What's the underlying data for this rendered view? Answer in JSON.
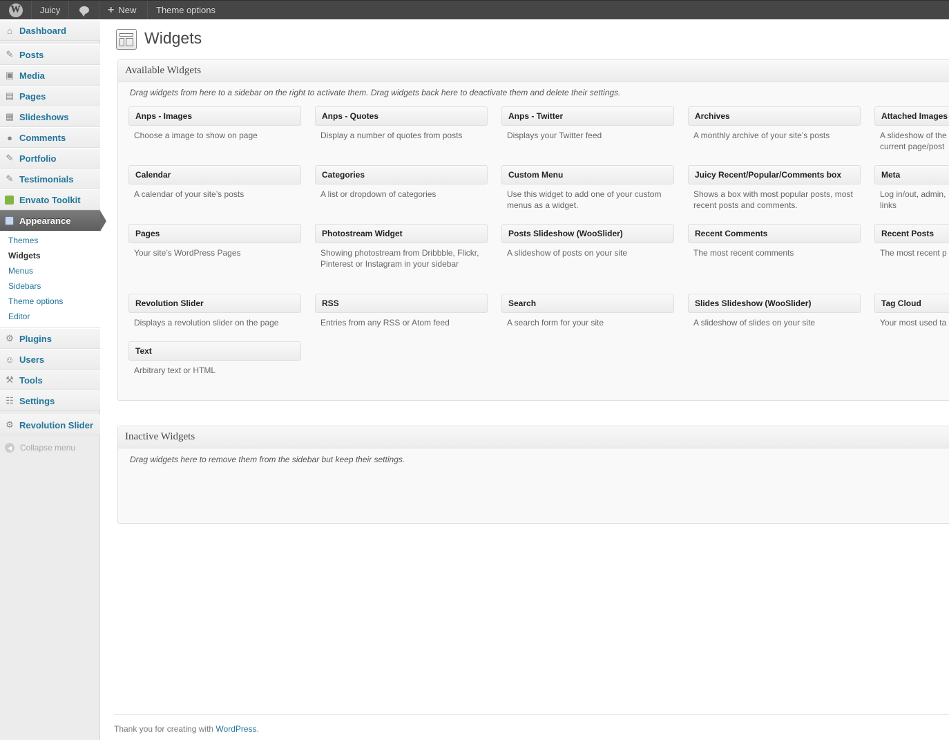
{
  "adminbar": {
    "site_name": "Juicy",
    "new_label": "New",
    "theme_options": "Theme options"
  },
  "sidebar": {
    "items": [
      {
        "label": "Dashboard",
        "icon": "dashboard-icon"
      },
      {
        "label": "Posts",
        "icon": "pin-icon"
      },
      {
        "label": "Media",
        "icon": "media-icon"
      },
      {
        "label": "Pages",
        "icon": "pages-icon"
      },
      {
        "label": "Slideshows",
        "icon": "slideshow-icon"
      },
      {
        "label": "Comments",
        "icon": "comments-icon"
      },
      {
        "label": "Portfolio",
        "icon": "pin-icon"
      },
      {
        "label": "Testimonials",
        "icon": "pin-icon"
      },
      {
        "label": "Envato Toolkit",
        "icon": "envato-icon"
      },
      {
        "label": "Appearance",
        "icon": "appearance-icon"
      },
      {
        "label": "Plugins",
        "icon": "plugins-icon"
      },
      {
        "label": "Users",
        "icon": "users-icon"
      },
      {
        "label": "Tools",
        "icon": "tools-icon"
      },
      {
        "label": "Settings",
        "icon": "settings-icon"
      },
      {
        "label": "Revolution Slider",
        "icon": "gear-icon"
      }
    ],
    "submenu": [
      "Themes",
      "Widgets",
      "Menus",
      "Sidebars",
      "Theme options",
      "Editor"
    ],
    "collapse": "Collapse menu"
  },
  "page": {
    "title": "Widgets"
  },
  "available": {
    "title": "Available Widgets",
    "description": "Drag widgets from here to a sidebar on the right to activate them. Drag widgets back here to deactivate them and delete their settings.",
    "widgets": [
      {
        "title": "Anps - Images",
        "desc": "Choose a image to show on page"
      },
      {
        "title": "Anps - Quotes",
        "desc": "Display a number of quotes from posts"
      },
      {
        "title": "Anps - Twitter",
        "desc": "Displays your Twitter feed"
      },
      {
        "title": "Archives",
        "desc": "A monthly archive of your site’s posts"
      },
      {
        "title": "Attached Images",
        "desc": "A slideshow of the current page/post"
      },
      {
        "title": "Calendar",
        "desc": "A calendar of your site’s posts"
      },
      {
        "title": "Categories",
        "desc": "A list or dropdown of categories"
      },
      {
        "title": "Custom Menu",
        "desc": "Use this widget to add one of your custom menus as a widget."
      },
      {
        "title": "Juicy Recent/Popular/Comments box",
        "desc": "Shows a box with most popular posts, most recent posts and comments."
      },
      {
        "title": "Meta",
        "desc": "Log in/out, admin, links"
      },
      {
        "title": "Pages",
        "desc": "Your site’s WordPress Pages"
      },
      {
        "title": "Photostream Widget",
        "desc": "Showing photostream from Dribbble, Flickr, Pinterest or Instagram in your sidebar"
      },
      {
        "title": "Posts Slideshow (WooSlider)",
        "desc": "A slideshow of posts on your site"
      },
      {
        "title": "Recent Comments",
        "desc": "The most recent comments"
      },
      {
        "title": "Recent Posts",
        "desc": "The most recent p"
      },
      {
        "title": "Revolution Slider",
        "desc": "Displays a revolution slider on the page"
      },
      {
        "title": "RSS",
        "desc": "Entries from any RSS or Atom feed"
      },
      {
        "title": "Search",
        "desc": "A search form for your site"
      },
      {
        "title": "Slides Slideshow (WooSlider)",
        "desc": "A slideshow of slides on your site"
      },
      {
        "title": "Tag Cloud",
        "desc": "Your most used ta"
      },
      {
        "title": "Text",
        "desc": "Arbitrary text or HTML"
      }
    ]
  },
  "inactive": {
    "title": "Inactive Widgets",
    "description": "Drag widgets here to remove them from the sidebar but keep their settings."
  },
  "footer": {
    "text": "Thank you for creating with",
    "link": "WordPress",
    "period": "."
  }
}
